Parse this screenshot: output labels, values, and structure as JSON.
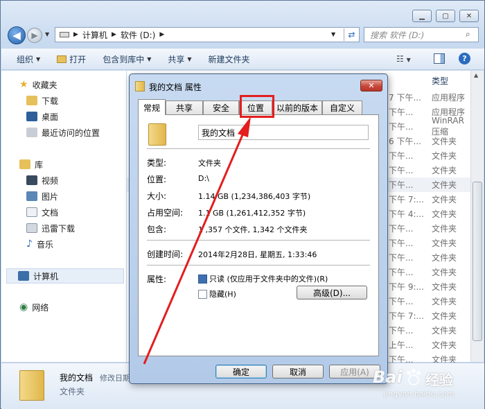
{
  "explorer": {
    "breadcrumb": [
      "计算机",
      "软件 (D:)"
    ],
    "search_placeholder": "搜索 软件 (D:)",
    "toolbar": {
      "organize": "组织",
      "open": "打开",
      "include_library": "包含到库中",
      "share": "共享",
      "new_folder": "新建文件夹"
    },
    "sidebar": {
      "favorites": "收藏夹",
      "fav_items": [
        "下载",
        "桌面",
        "最近访问的位置"
      ],
      "libraries": "库",
      "lib_items": [
        "视频",
        "图片",
        "文档",
        "迅雷下载",
        "音乐"
      ],
      "computer": "计算机",
      "network": "网络"
    },
    "column_type": "类型",
    "files": [
      {
        "date": "7 下午...",
        "type": "应用程序"
      },
      {
        "date": "下午...",
        "type": "应用程序"
      },
      {
        "date": "下午...",
        "type": "WinRAR 压缩"
      },
      {
        "date": "6 下午...",
        "type": "文件夹"
      },
      {
        "date": "下午...",
        "type": "文件夹"
      },
      {
        "date": "下午...",
        "type": "文件夹"
      },
      {
        "date": "下午...",
        "type": "文件夹"
      },
      {
        "date": "下午 7:...",
        "type": "文件夹"
      },
      {
        "date": "下午 4:...",
        "type": "文件夹"
      },
      {
        "date": "下午...",
        "type": "文件夹"
      },
      {
        "date": "下午...",
        "type": "文件夹"
      },
      {
        "date": "下午...",
        "type": "文件夹"
      },
      {
        "date": "下午...",
        "type": "文件夹"
      },
      {
        "date": "下午 9:...",
        "type": "文件夹"
      },
      {
        "date": "下午...",
        "type": "文件夹"
      },
      {
        "date": "下午 7:...",
        "type": "文件夹"
      },
      {
        "date": "下午...",
        "type": "文件夹"
      },
      {
        "date": "上午...",
        "type": "文件夹"
      },
      {
        "date": "下午...",
        "type": "文件夹"
      }
    ],
    "details": {
      "name": "我的文档",
      "modified_label": "修改日期",
      "kind": "文件夹"
    }
  },
  "dialog": {
    "title": "我的文档 属性",
    "tabs": [
      "常规",
      "共享",
      "安全",
      "位置",
      "以前的版本",
      "自定义"
    ],
    "folder_name": "我的文档",
    "rows": [
      {
        "label": "类型:",
        "value": "文件夹"
      },
      {
        "label": "位置:",
        "value": "D:\\"
      },
      {
        "label": "大小:",
        "value": "1.14 GB (1,234,386,403 字节)"
      },
      {
        "label": "占用空间:",
        "value": "1.1  GB (1,261,412,352 字节)"
      },
      {
        "label": "包含:",
        "value": "1 ,357 个文件, 1,342 个文件夹"
      }
    ],
    "created_label": "创建时间:",
    "created_value": "2014年2月28日, 星期五, 1:33:46",
    "attributes_label": "属性:",
    "readonly_label": "只读 (仅应用于文件夹中的文件)(R)",
    "hidden_label": "隐藏(H)",
    "advanced_button": "高级(D)...",
    "ok_button": "确定",
    "cancel_button": "取消",
    "apply_button": "应用(A)"
  },
  "watermark": {
    "brand": "Bai",
    "brand2": "经验",
    "url": "jingyan.baidu.com"
  },
  "colors": {
    "highlight": "#e41d1d",
    "arrow": "#e41d1d",
    "accent": "#3c7fb1"
  }
}
